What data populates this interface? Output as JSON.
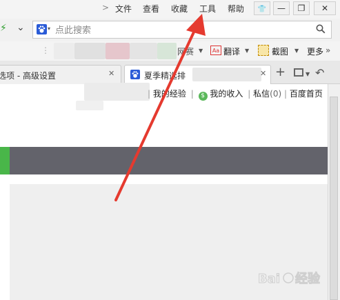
{
  "menu": {
    "more_arrow": ">",
    "items": [
      "文件",
      "查看",
      "收藏",
      "工具",
      "帮助"
    ]
  },
  "window_controls": {
    "skin": "👕",
    "minimize": "—",
    "maximize": "❐",
    "close": "✕"
  },
  "addressbar": {
    "speed_icon": "⚡",
    "dropdown": "⌄",
    "search_engine_icon": "paw-icon",
    "search_placeholder": "点此搜索",
    "search_button_icon": "search-icon"
  },
  "toolbar": {
    "grip": "⋮",
    "partial_label": "网赛",
    "translate_label": "翻译",
    "screenshot_label": "截图",
    "more_label": "更多",
    "more_arrow": "»",
    "dropdown_arrow": "▼"
  },
  "tabs": [
    {
      "title": "选项 - 高级设置",
      "close": "✕",
      "active": false
    },
    {
      "title": "夏季精选排",
      "close": "✕",
      "active": true
    }
  ],
  "tab_actions": {
    "new_tab": "+",
    "restore": "↶"
  },
  "page": {
    "user_links": {
      "my_experience": "我的经验",
      "my_income": "我的收入",
      "messages_label": "私信",
      "messages_count": "(0)",
      "baidu_home": "百度首页",
      "separator": "|"
    }
  },
  "colors": {
    "accent_green": "#49b649",
    "dark_bar": "#63636b",
    "annotation_red": "#e53a2f"
  }
}
